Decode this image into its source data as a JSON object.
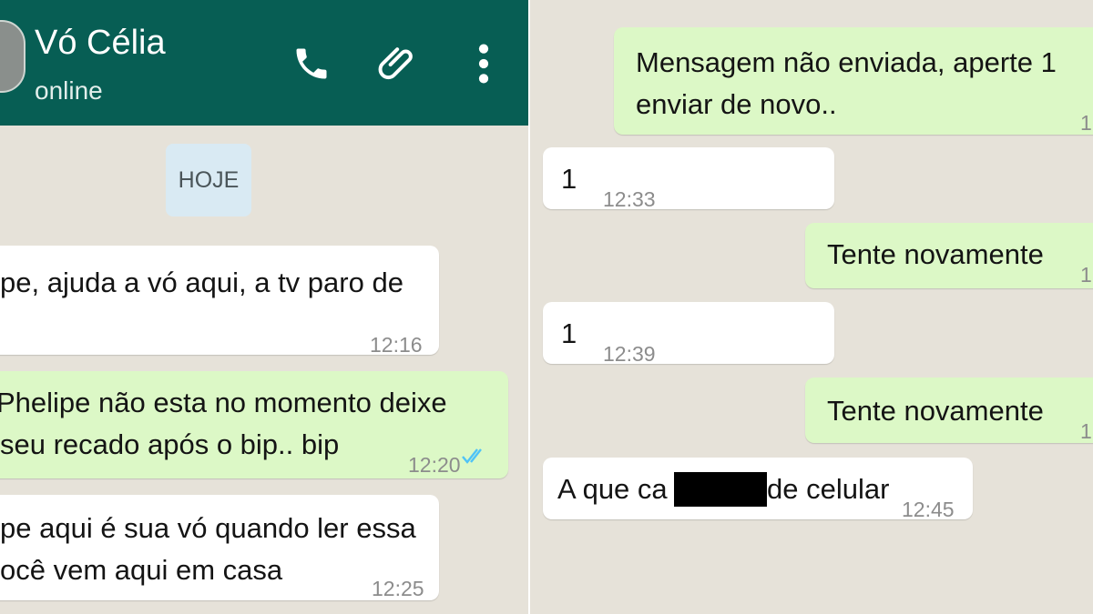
{
  "left_chat": {
    "contact_name": "Vó Célia",
    "contact_status": "online",
    "date_chip": "HOJE",
    "messages": [
      {
        "direction": "incoming",
        "lines": [
          "pe, ajuda a vó aqui, a tv paro de"
        ],
        "time": "12:16"
      },
      {
        "direction": "outgoing",
        "lines": [
          "Phelipe não esta no momento deixe",
          "seu recado após o bip.. bip"
        ],
        "time": "12:20",
        "status_icon": "double-check-icon"
      },
      {
        "direction": "incoming",
        "lines": [
          "pe aqui é sua vó quando ler essa",
          "ocê vem aqui em casa"
        ],
        "time": "12:25"
      }
    ]
  },
  "right_chat": {
    "messages": [
      {
        "direction": "outgoing",
        "lines": [
          "Mensagem não enviada, aperte 1",
          "enviar de novo.."
        ],
        "time": "1"
      },
      {
        "direction": "incoming",
        "lines": [
          "1"
        ],
        "time": "12:33"
      },
      {
        "direction": "outgoing",
        "lines": [
          "Tente novamente"
        ],
        "time": "1"
      },
      {
        "direction": "incoming",
        "lines": [
          "1"
        ],
        "time": "12:39"
      },
      {
        "direction": "outgoing",
        "lines": [
          "Tente novamente"
        ],
        "time": "1"
      },
      {
        "direction": "incoming",
        "lines": [
          "A que ca",
          "de celular"
        ],
        "time": "12:45",
        "redacted": true
      }
    ]
  },
  "colors": {
    "header": "#075e54",
    "background": "#e6e2d9",
    "outgoing_bubble": "#dcf8c6",
    "incoming_bubble": "#ffffff",
    "read_ticks": "#4fc3f7"
  },
  "icons": [
    "phone-icon",
    "paperclip-icon",
    "more-vert-icon",
    "double-check-icon"
  ]
}
